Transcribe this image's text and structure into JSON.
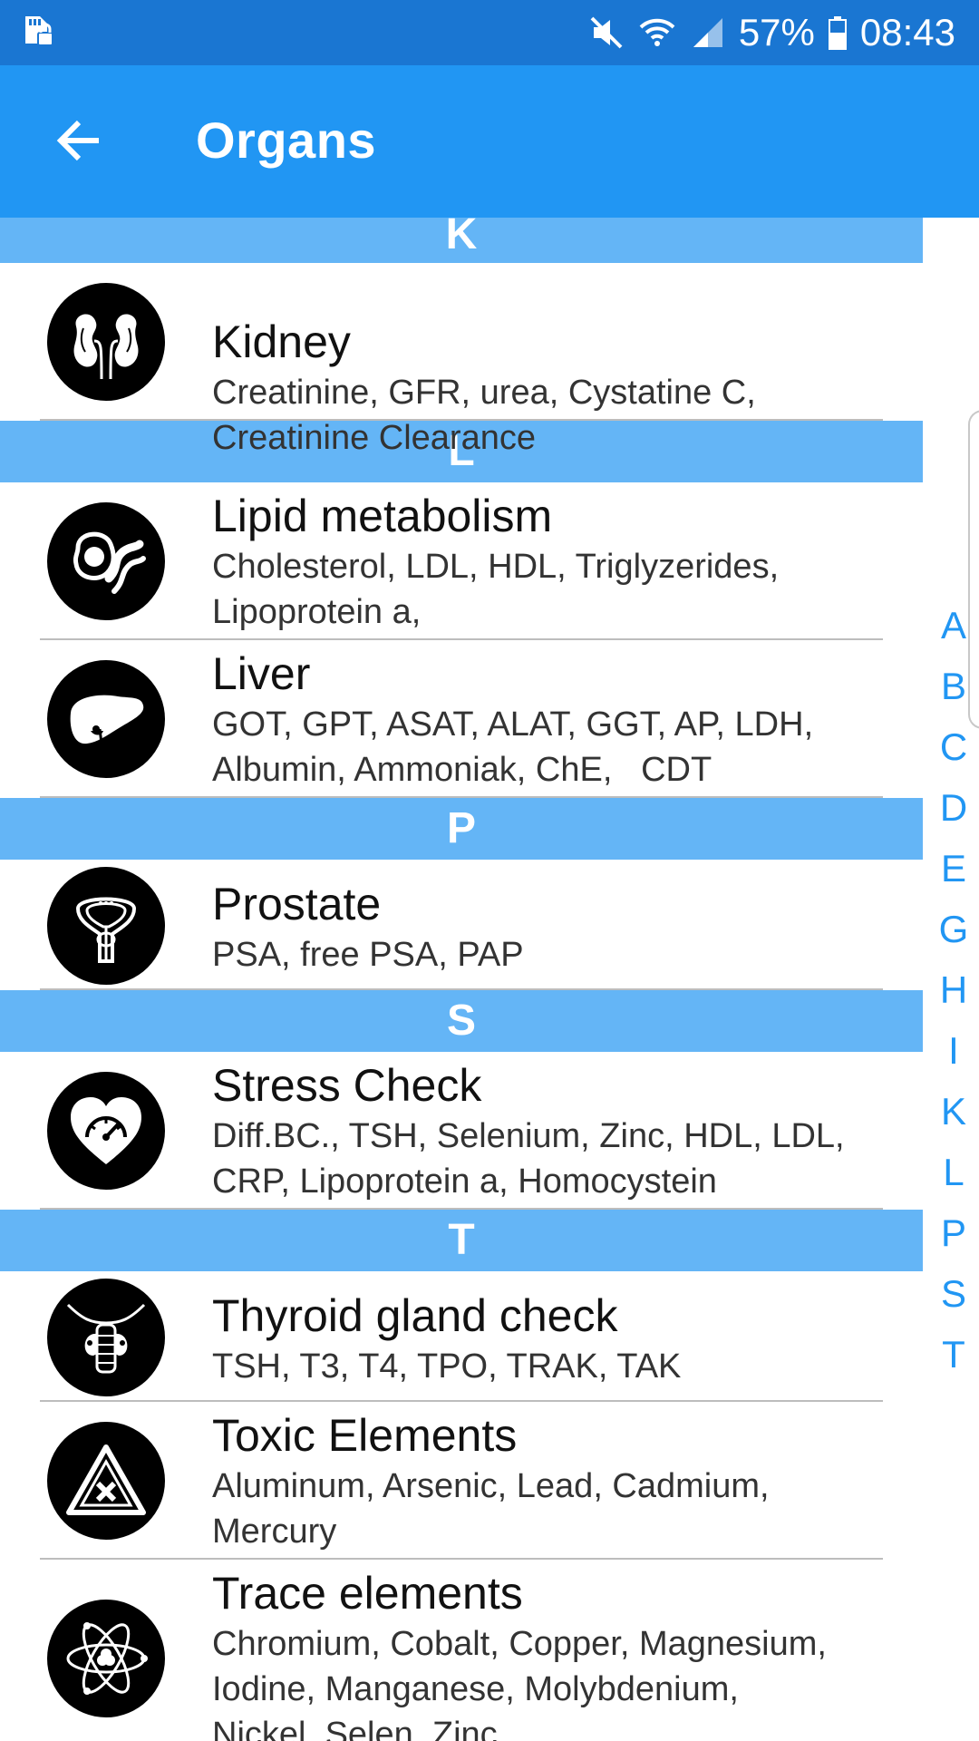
{
  "status_bar": {
    "battery": "57%",
    "time": "08:43"
  },
  "app_bar": {
    "title": "Organs"
  },
  "colors": {
    "status_bar": "#1a76d2",
    "app_bar": "#2196f3",
    "section_header": "#64b5f6",
    "index_text": "#2196f3"
  },
  "sections": [
    {
      "letter": "K"
    },
    {
      "letter": "L"
    },
    {
      "letter": "P"
    },
    {
      "letter": "S"
    },
    {
      "letter": "T"
    }
  ],
  "items": [
    {
      "name": "Kidney",
      "tests": "Creatinine, GFR, urea, Cystatine C,\nCreatinine Clearance",
      "icon": "kidney-icon"
    },
    {
      "name": "Lipid metabolism",
      "tests": "Cholesterol, LDL, HDL, Triglyzerides,\nLipoprotein a,",
      "icon": "lipid-icon"
    },
    {
      "name": "Liver",
      "tests": "GOT, GPT, ASAT, ALAT, GGT, AP, LDH,\nAlbumin, Ammoniak, ChE,   CDT",
      "icon": "liver-icon"
    },
    {
      "name": "Prostate",
      "tests": "PSA, free PSA, PAP",
      "icon": "prostate-icon"
    },
    {
      "name": "Stress Check",
      "tests": "Diff.BC., TSH, Selenium, Zinc, HDL, LDL,\nCRP, Lipoprotein a, Homocystein",
      "icon": "heart-gauge-icon"
    },
    {
      "name": "Thyroid gland check",
      "tests": "TSH, T3, T4, TPO, TRAK, TAK",
      "icon": "thyroid-icon"
    },
    {
      "name": "Toxic Elements",
      "tests": "Aluminum, Arsenic, Lead, Cadmium,\nMercury",
      "icon": "toxic-warning-icon"
    },
    {
      "name": "Trace elements",
      "tests": "Chromium, Cobalt, Copper, Magnesium,\nIodine, Manganese, Molybdenium,\nNickel, Selen, Zinc",
      "icon": "atom-icon"
    }
  ],
  "index_letters": [
    "A",
    "B",
    "C",
    "D",
    "E",
    "G",
    "H",
    "I",
    "K",
    "L",
    "P",
    "S",
    "T"
  ]
}
